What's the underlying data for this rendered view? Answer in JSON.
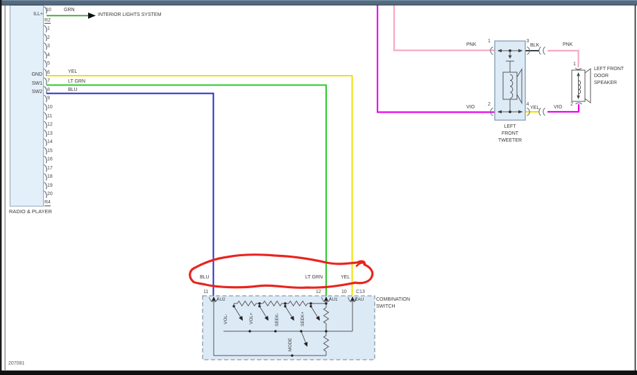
{
  "radio": {
    "title": "RADIO & PLAYER",
    "ill_label": "ILL+",
    "pin10": "10",
    "r2": "R2",
    "r4": "R4",
    "gnd": "GND",
    "sw1": "SW1",
    "sw2": "SW2",
    "grn": "GRN",
    "interior": "INTERIOR LIGHTS SYSTEM",
    "yel": "YEL",
    "ltgrn": "LT GRN",
    "blu": "BLU",
    "pins": [
      "1",
      "2",
      "3",
      "4",
      "5",
      "6",
      "7",
      "8",
      "9",
      "10",
      "11",
      "12",
      "13",
      "14",
      "15",
      "16",
      "17",
      "18",
      "19",
      "20"
    ]
  },
  "tweeter": {
    "pin1": "1",
    "pin2": "2",
    "pin3": "3",
    "pin4": "4",
    "pnk_left": "PNK",
    "vio_left": "VIO",
    "blk": "BLK",
    "yel": "YEL",
    "pnk_right": "PNK",
    "vio_right": "VIO",
    "title_lines": [
      "LEFT",
      "FRONT",
      "TWEETER"
    ]
  },
  "door_speaker": {
    "pin1": "1",
    "pin2": "2",
    "title_lines": [
      "LEFT FRONT",
      "DOOR",
      "SPEAKER"
    ]
  },
  "switch": {
    "blu": "BLU",
    "ltgrn": "LT GRN",
    "yel": "YEL",
    "pin11": "11",
    "pin12": "12",
    "pin10": "10",
    "c13": "C13",
    "au2": "AU2",
    "au1": "AU1",
    "eau": "EAU",
    "sw": [
      "VOL-",
      "VOL+",
      "SEEK-",
      "SEEK+",
      "MODE"
    ],
    "title_lines": [
      "COMBINATION",
      "SWITCH"
    ]
  },
  "footer": {
    "code": "207081"
  },
  "colors": {
    "top_bar": "#546a80",
    "wire_green": "#2f9e2f",
    "wire_lt_green": "#28c828",
    "wire_yellow": "#f2e000",
    "wire_blue": "#2828c8",
    "wire_pink": "#f8a8c2",
    "wire_magenta": "#ee00ee",
    "wire_black": "#3c3c3c",
    "annotation_red": "#e8251d",
    "block_fill": "#e3eff9"
  }
}
